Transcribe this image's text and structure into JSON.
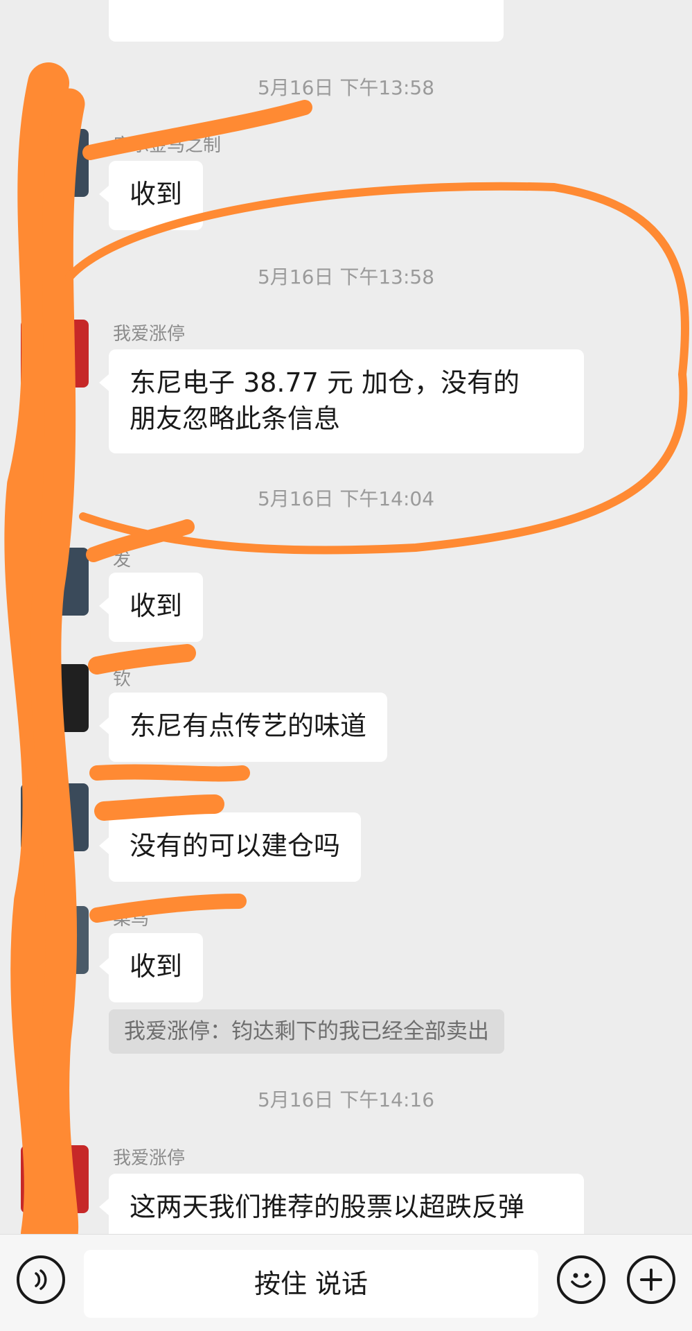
{
  "messages": [
    {
      "type": "bubble",
      "sender": "康乐金马之制",
      "text": "收到"
    },
    {
      "type": "timestamp",
      "text": "5月16日 下午13:58"
    },
    {
      "type": "bubble",
      "sender": "我爱涨停",
      "text_line1": "东尼电子  38.77 元  加仓，没有的",
      "text_line2": "朋友忽略此条信息"
    },
    {
      "type": "timestamp",
      "text": "5月16日 下午14:04"
    },
    {
      "type": "bubble",
      "sender": "发",
      "text": "收到"
    },
    {
      "type": "bubble",
      "sender": "钦",
      "text": "东尼有点传艺的味道"
    },
    {
      "type": "bubble",
      "text": "没有的可以建仓吗"
    },
    {
      "type": "bubble",
      "sender": "菜鸟",
      "text": "收到"
    },
    {
      "type": "system",
      "text": "我爱涨停：钧达剩下的我已经全部卖出"
    },
    {
      "type": "timestamp",
      "text": "5月16日 下午14:16"
    },
    {
      "type": "bubble",
      "sender": "我爱涨停",
      "text": "这两天我们推荐的股票以超跌反弹"
    }
  ],
  "timestamps": [
    "5月16日 下午13:58",
    "5月16日 下午13:58",
    "5月16日 下午14:04",
    "5月16日 下午14:16"
  ],
  "input_bar": {
    "voice_label": "按住 说话",
    "left_icon": "voice-icon",
    "emoji_icon": "emoji-icon",
    "plus_icon": "plus-icon"
  },
  "colors": {
    "background": "#ededed",
    "bubble": "#ffffff",
    "scribble": "#ff8a33",
    "timestamp_text": "#9a9a9a"
  }
}
